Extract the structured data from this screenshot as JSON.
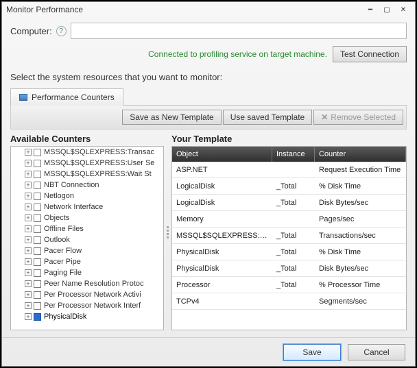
{
  "title": "Monitor Performance",
  "computer_label": "Computer:",
  "computer_value": "",
  "status_text": "Connected to profiling service on target machine.",
  "test_connection_label": "Test Connection",
  "prompt_text": "Select the system resources that you want to monitor:",
  "tab_label": "Performance Counters",
  "toolbar": {
    "save_template": "Save as New Template",
    "use_template": "Use saved Template",
    "remove_selected": "Remove Selected"
  },
  "available_header": "Available Counters",
  "your_template_header": "Your Template",
  "footer": {
    "save": "Save",
    "cancel": "Cancel"
  },
  "counters": [
    {
      "label": "MSSQL$SQLEXPRESS:Transac",
      "checked": false
    },
    {
      "label": "MSSQL$SQLEXPRESS:User Se",
      "checked": false
    },
    {
      "label": "MSSQL$SQLEXPRESS:Wait St",
      "checked": false
    },
    {
      "label": "NBT Connection",
      "checked": false
    },
    {
      "label": "Netlogon",
      "checked": false
    },
    {
      "label": "Network Interface",
      "checked": false
    },
    {
      "label": "Objects",
      "checked": false
    },
    {
      "label": "Offline Files",
      "checked": false
    },
    {
      "label": "Outlook",
      "checked": false
    },
    {
      "label": "Pacer Flow",
      "checked": false
    },
    {
      "label": "Pacer Pipe",
      "checked": false
    },
    {
      "label": "Paging File",
      "checked": false
    },
    {
      "label": "Peer Name Resolution Protoc",
      "checked": false
    },
    {
      "label": "Per Processor Network Activi",
      "checked": false
    },
    {
      "label": "Per Processor Network Interf",
      "checked": false
    },
    {
      "label": "PhysicalDisk",
      "checked": true
    }
  ],
  "grid": {
    "headers": {
      "object": "Object",
      "instance": "Instance",
      "counter": "Counter"
    },
    "rows": [
      {
        "object": "ASP.NET",
        "instance": "",
        "counter": "Request Execution Time"
      },
      {
        "object": "LogicalDisk",
        "instance": "_Total",
        "counter": "% Disk Time"
      },
      {
        "object": "LogicalDisk",
        "instance": "_Total",
        "counter": "Disk Bytes/sec"
      },
      {
        "object": "Memory",
        "instance": "",
        "counter": "Pages/sec"
      },
      {
        "object": "MSSQL$SQLEXPRESS:Dat",
        "instance": "_Total",
        "counter": "Transactions/sec"
      },
      {
        "object": "PhysicalDisk",
        "instance": "_Total",
        "counter": "% Disk Time"
      },
      {
        "object": "PhysicalDisk",
        "instance": "_Total",
        "counter": "Disk Bytes/sec"
      },
      {
        "object": "Processor",
        "instance": "_Total",
        "counter": "% Processor Time"
      },
      {
        "object": "TCPv4",
        "instance": "",
        "counter": "Segments/sec"
      }
    ]
  }
}
